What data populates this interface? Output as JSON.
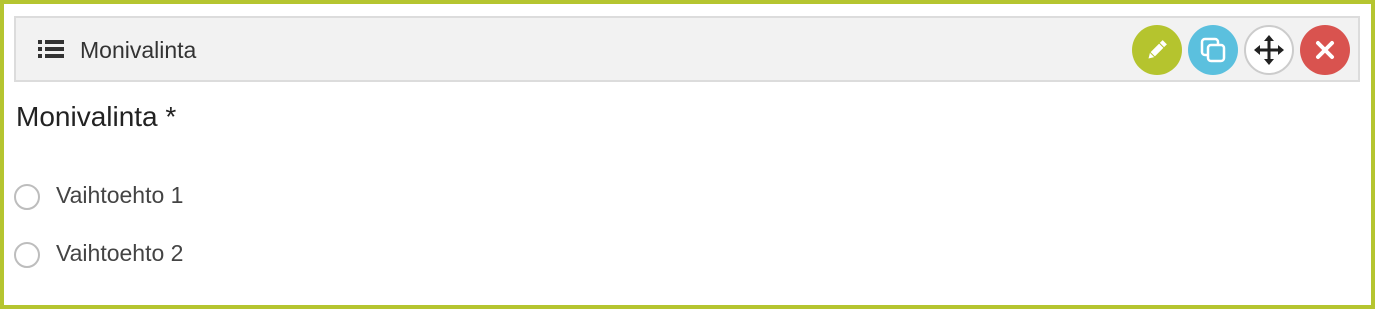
{
  "header": {
    "title": "Monivalinta",
    "icon": "list-icon",
    "actions": [
      {
        "name": "edit",
        "icon": "pencil-icon",
        "color": "#b5c42e"
      },
      {
        "name": "copy",
        "icon": "copy-icon",
        "color": "#5bc0de"
      },
      {
        "name": "move",
        "icon": "move-icon",
        "color": "#ffffff"
      },
      {
        "name": "delete",
        "icon": "close-icon",
        "color": "#d9534f"
      }
    ]
  },
  "question": {
    "title": "Monivalinta *",
    "options": [
      {
        "label": "Vaihtoehto 1",
        "checked": false
      },
      {
        "label": "Vaihtoehto 2",
        "checked": false
      }
    ]
  },
  "colors": {
    "accent_border": "#b5c530",
    "toolbar_bg": "#f2f2f2"
  }
}
